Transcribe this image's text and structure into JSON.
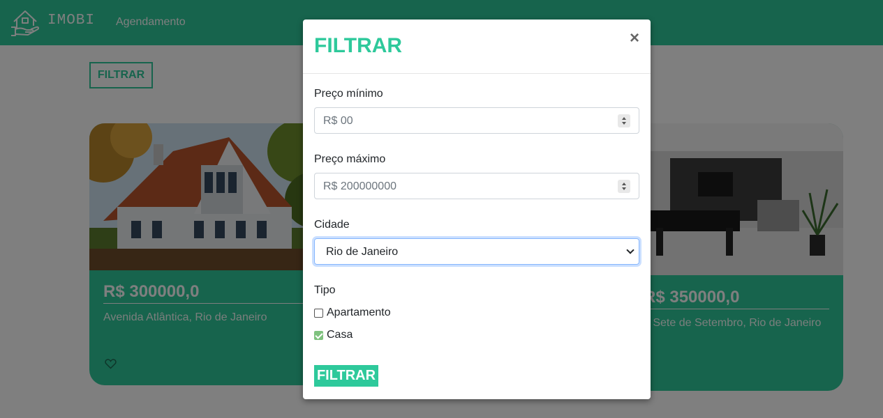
{
  "navbar": {
    "brand": "IMOBI",
    "link": "Agendamento"
  },
  "page": {
    "filter_button": "FILTRAR"
  },
  "cards": [
    {
      "price": "R$ 300000,0",
      "address": "Avenida Atlântica, Rio de Janeiro"
    },
    {
      "price": "R$ 350000,0",
      "address": "a Sete de Setembro, Rio de Janeiro"
    }
  ],
  "modal": {
    "title": "FILTRAR",
    "close": "×",
    "min_price_label": "Preço mínimo",
    "min_price_placeholder": "R$ 00",
    "max_price_label": "Preço máximo",
    "max_price_placeholder": "R$ 200000000",
    "city_label": "Cidade",
    "city_value": "Rio de Janeiro",
    "type_label": "Tipo",
    "types": [
      {
        "label": "Apartamento",
        "checked": false
      },
      {
        "label": "Casa",
        "checked": true
      }
    ],
    "submit": "FILTRAR"
  },
  "colors": {
    "accent": "#2ec99b",
    "overlay": "rgba(0,0,0,0.5)"
  },
  "icons": [
    "house-logo-icon",
    "heart-icon",
    "close-icon",
    "chevron-down-icon",
    "spinner-icon",
    "checkbox-icon"
  ]
}
